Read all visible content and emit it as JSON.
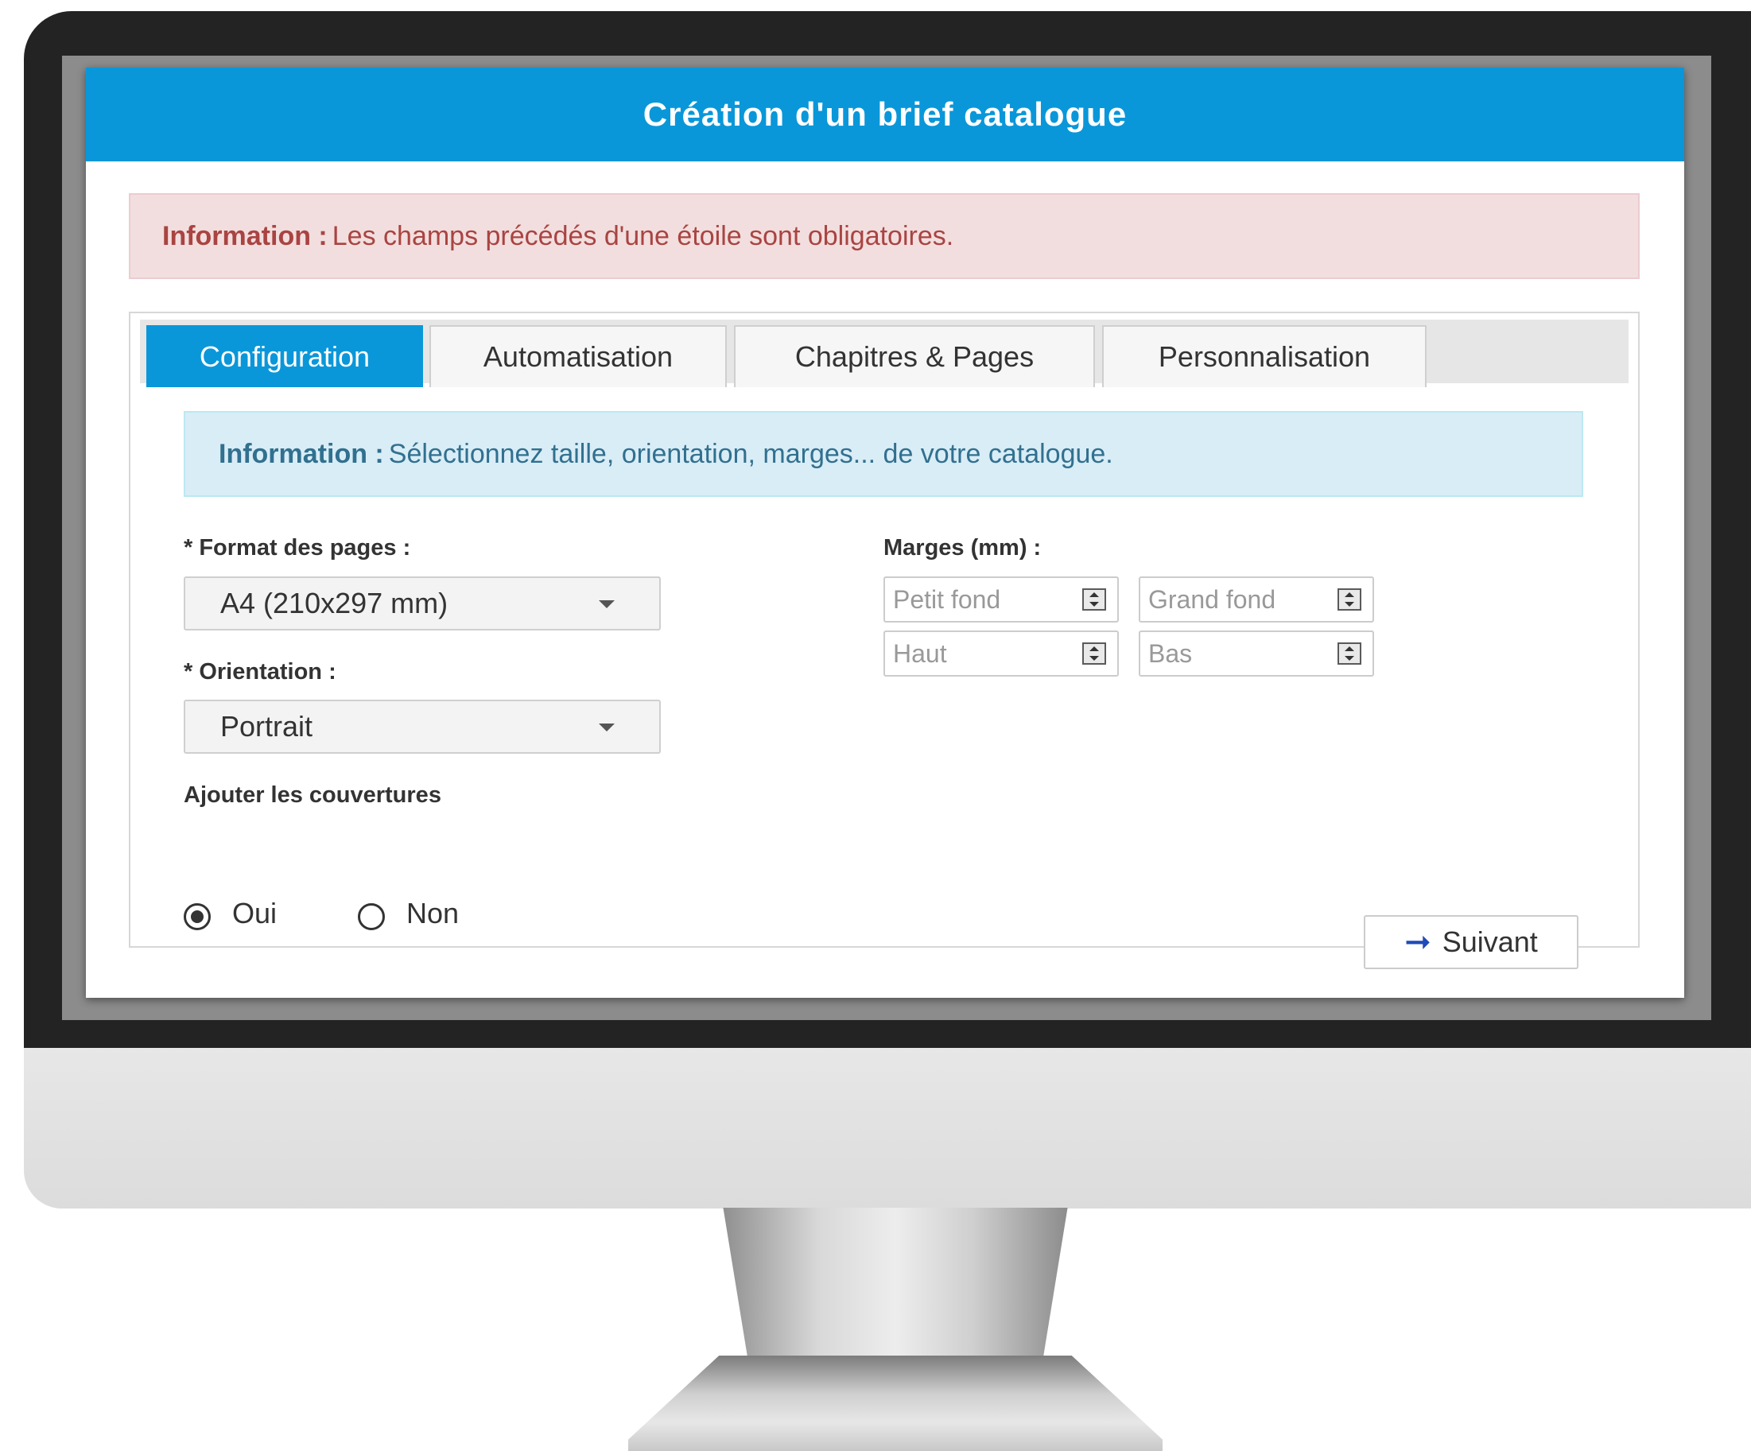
{
  "dialog": {
    "title": "Création d'un brief catalogue"
  },
  "alert_required": {
    "strong": "Information :",
    "text": "Les champs précédés d'une étoile sont obligatoires."
  },
  "tabs": [
    {
      "label": "Configuration",
      "active": true
    },
    {
      "label": "Automatisation",
      "active": false
    },
    {
      "label": "Chapitres & Pages",
      "active": false
    },
    {
      "label": "Personnalisation",
      "active": false
    }
  ],
  "alert_info": {
    "strong": "Information :",
    "text": "Sélectionnez taille, orientation, marges... de votre catalogue."
  },
  "format": {
    "label": "* Format des pages :",
    "value": "A4 (210x297 mm)"
  },
  "orientation": {
    "label": "* Orientation :",
    "value": "Portrait"
  },
  "margins": {
    "label": "Marges (mm) :",
    "fields": [
      {
        "placeholder": "Petit fond"
      },
      {
        "placeholder": "Grand fond"
      },
      {
        "placeholder": "Haut"
      },
      {
        "placeholder": "Bas"
      }
    ]
  },
  "covers": {
    "label": "Ajouter les couvertures",
    "options": [
      {
        "label": "Oui",
        "selected": true
      },
      {
        "label": "Non",
        "selected": false
      }
    ]
  },
  "next_button": {
    "label": "Suivant",
    "icon": "arrow-right-icon"
  },
  "colors": {
    "header": "#0a97d9",
    "danger_text": "#a94442",
    "info_text": "#31708f",
    "arrow": "#1f4bb7"
  }
}
